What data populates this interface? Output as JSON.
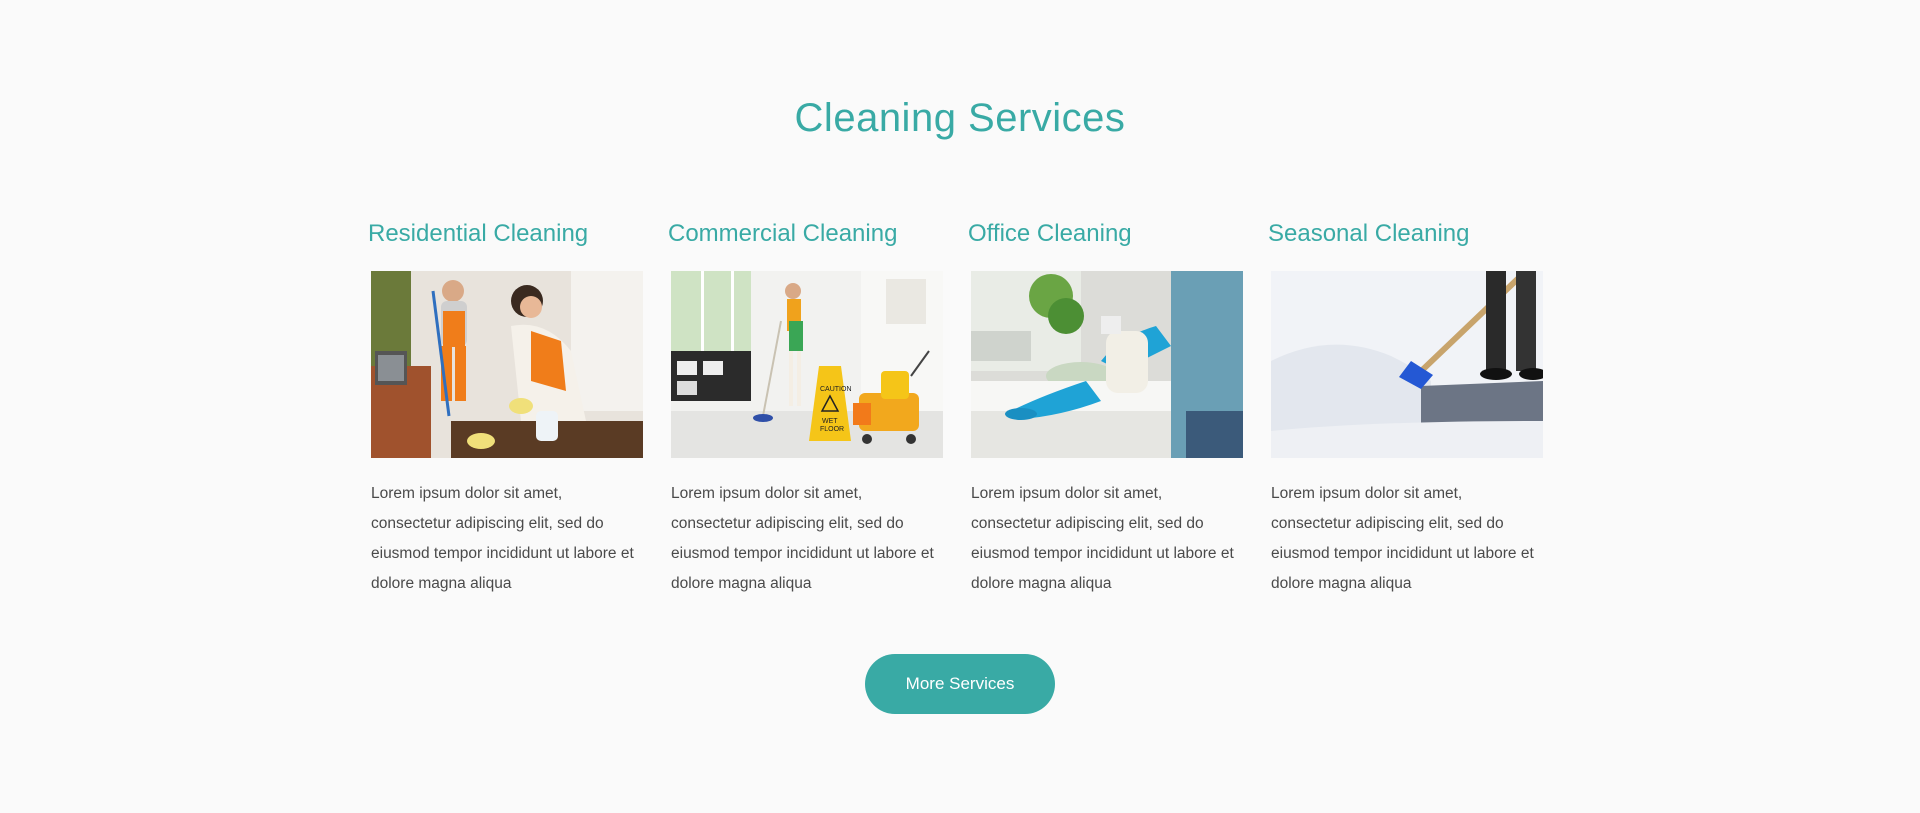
{
  "section": {
    "title": "Cleaning Services"
  },
  "services": [
    {
      "title": "Residential Cleaning",
      "image_icon": "residential-cleaning-photo",
      "description": "Lorem ipsum dolor sit amet, consectetur adipiscing elit, sed do eiusmod tempor incididunt ut labore et dolore magna aliqua"
    },
    {
      "title": "Commercial Cleaning",
      "image_icon": "commercial-cleaning-photo",
      "description": "Lorem ipsum dolor sit amet, consectetur adipiscing elit, sed do eiusmod tempor incididunt ut labore et dolore magna aliqua"
    },
    {
      "title": "Office Cleaning",
      "image_icon": "office-cleaning-photo",
      "description": "Lorem ipsum dolor sit amet, consectetur adipiscing elit, sed do eiusmod tempor incididunt ut labore et dolore magna aliqua"
    },
    {
      "title": "Seasonal Cleaning",
      "image_icon": "seasonal-cleaning-photo",
      "description": "Lorem ipsum dolor sit amet, consectetur adipiscing elit, sed do eiusmod tempor incididunt ut labore et dolore magna aliqua"
    }
  ],
  "more_button": {
    "label": "More Services"
  },
  "colors": {
    "accent": "#39aaa5",
    "background": "#fafafa",
    "body_text": "#4a4a4a"
  }
}
